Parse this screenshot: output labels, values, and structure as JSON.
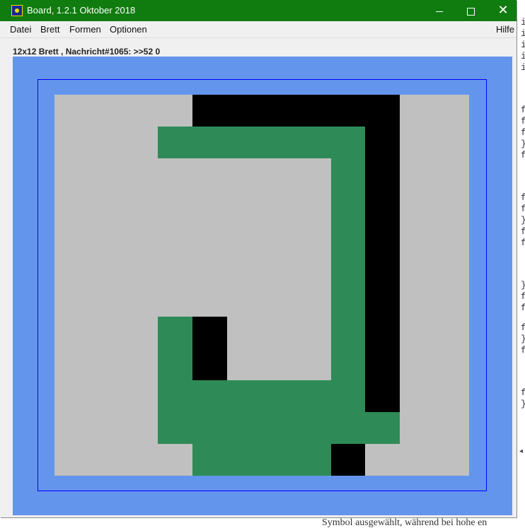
{
  "window": {
    "title": "Board, 1.2.1 Oktober 2018",
    "controls": {
      "minimize": "minimize",
      "maximize": "maximize",
      "close": "close"
    }
  },
  "menu": {
    "items": [
      "Datei",
      "Brett",
      "Formen",
      "Optionen"
    ],
    "help": "Hilfe"
  },
  "status": "12x12 Brett , Nachricht#1065: >>52 0",
  "board": {
    "rows": 12,
    "cols": 12,
    "colors": {
      "0": "#c0c0c0",
      "1": "#000000",
      "2": "#2e8b57"
    },
    "cells": [
      [
        0,
        0,
        0,
        0,
        1,
        1,
        1,
        1,
        1,
        1,
        0,
        0
      ],
      [
        0,
        0,
        0,
        2,
        2,
        2,
        2,
        2,
        2,
        1,
        0,
        0
      ],
      [
        0,
        0,
        0,
        0,
        0,
        0,
        0,
        0,
        2,
        1,
        0,
        0
      ],
      [
        0,
        0,
        0,
        0,
        0,
        0,
        0,
        0,
        2,
        1,
        0,
        0
      ],
      [
        0,
        0,
        0,
        0,
        0,
        0,
        0,
        0,
        2,
        1,
        0,
        0
      ],
      [
        0,
        0,
        0,
        0,
        0,
        0,
        0,
        0,
        2,
        1,
        0,
        0
      ],
      [
        0,
        0,
        0,
        0,
        0,
        0,
        0,
        0,
        2,
        1,
        0,
        0
      ],
      [
        0,
        0,
        0,
        2,
        1,
        0,
        0,
        0,
        2,
        1,
        0,
        0
      ],
      [
        0,
        0,
        0,
        2,
        1,
        0,
        0,
        0,
        2,
        1,
        0,
        0
      ],
      [
        0,
        0,
        0,
        2,
        2,
        2,
        2,
        2,
        2,
        1,
        0,
        0
      ],
      [
        0,
        0,
        0,
        2,
        2,
        2,
        2,
        2,
        2,
        2,
        0,
        0
      ],
      [
        0,
        0,
        0,
        0,
        2,
        2,
        2,
        2,
        1,
        0,
        0,
        0
      ]
    ],
    "background_color": "#6495ed",
    "frame_color": "#0000ff"
  },
  "background_app": {
    "edge_chars": [
      "i",
      "i",
      "i",
      "i",
      "i",
      "f",
      "f",
      "f",
      "}",
      "f",
      "f",
      "f",
      "}",
      "f",
      "f",
      "}",
      "f",
      "f",
      "f",
      "}",
      "f",
      "f",
      "}"
    ],
    "bottom_text": "Symbol ausgewählt, während bei hohe en"
  }
}
